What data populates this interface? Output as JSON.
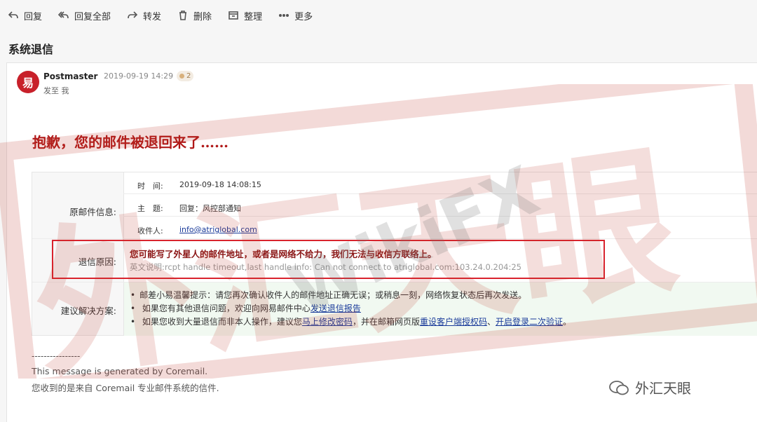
{
  "toolbar": {
    "reply": "回复",
    "reply_all": "回复全部",
    "forward": "转发",
    "delete": "删除",
    "organize": "整理",
    "more": "更多"
  },
  "subject": "系统退信",
  "sender": {
    "avatar_letter": "易",
    "name": "Postmaster",
    "time": "2019-09-19 14:29",
    "badge": "2",
    "to": "发至 我"
  },
  "headline": "抱歉，您的邮件被退回来了……",
  "original": {
    "label": "原邮件信息:",
    "time_name": "时　间:",
    "time_value": "2019-09-18 14:08:15",
    "subject_name": "主　题:",
    "subject_value": "回复：风控部通知",
    "recipient_name": "收件人:",
    "recipient_value": "info@atriglobal.com"
  },
  "reason": {
    "label": "退信原因:",
    "main": "您可能写了外星人的邮件地址，或者是网络不给力，我们无法与收信方联络上。",
    "detail": "英文说明:rcpt handle timeout,last handle info: Can not connect to atriglobal.com:103.24.0.204:25"
  },
  "advice": {
    "label": "建议解决方案:",
    "item1": "邮差小易温馨提示：请您再次确认收件人的邮件地址正确无误；或稍息一刻，网络恢复状态后再次发送。",
    "item2_pre": "如果您有其他退信问题，欢迎向网易邮件中心",
    "item2_link": "发送退信报告",
    "item3_pre": "如果您收到大量退信而非本人操作，建议您",
    "item3_link1": "马上修改密码",
    "item3_mid": "，并在邮箱网页版",
    "item3_link2": "重设客户端授权码",
    "item3_sep": "、",
    "item3_link3": "开启登录二次验证",
    "item3_end": "。"
  },
  "footer": {
    "line": "----------------",
    "generated": "This message is generated by Coremail.",
    "source": "您收到的是来自 Coremail 专业邮件系统的信件."
  },
  "watermark": {
    "stamp_text": "WikiFX",
    "stamp_chars": "外汇天眼",
    "brand": "外汇天眼"
  },
  "colors": {
    "headline": "#b01818",
    "highlight_border": "#d9232d",
    "link": "#1a3b9a",
    "avatar": "#c8202a"
  }
}
